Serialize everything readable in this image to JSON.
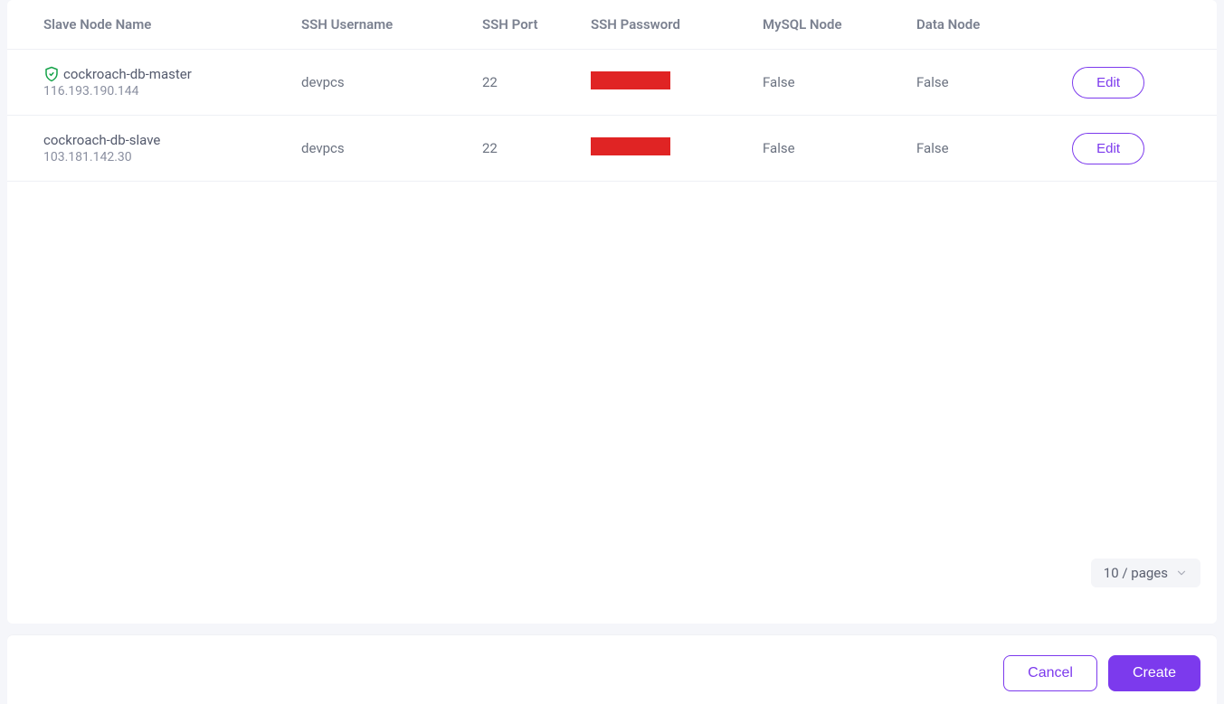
{
  "table": {
    "headers": {
      "name": "Slave Node Name",
      "ssh_user": "SSH Username",
      "ssh_port": "SSH Port",
      "ssh_pass": "SSH Password",
      "mysql_node": "MySQL Node",
      "data_node": "Data Node"
    },
    "rows": [
      {
        "name": "cockroach-db-master",
        "ip": "116.193.190.144",
        "has_shield": true,
        "ssh_user": "devpcs",
        "ssh_port": "22",
        "mysql_node": "False",
        "data_node": "False",
        "action_label": "Edit"
      },
      {
        "name": "cockroach-db-slave",
        "ip": "103.181.142.30",
        "has_shield": false,
        "ssh_user": "devpcs",
        "ssh_port": "22",
        "mysql_node": "False",
        "data_node": "False",
        "action_label": "Edit"
      }
    ]
  },
  "pagination": {
    "per_page_label": "10 / pages"
  },
  "footer": {
    "cancel_label": "Cancel",
    "create_label": "Create"
  },
  "colors": {
    "accent": "#7c3aed",
    "redacted": "#e02424",
    "shield": "#16a34a"
  }
}
